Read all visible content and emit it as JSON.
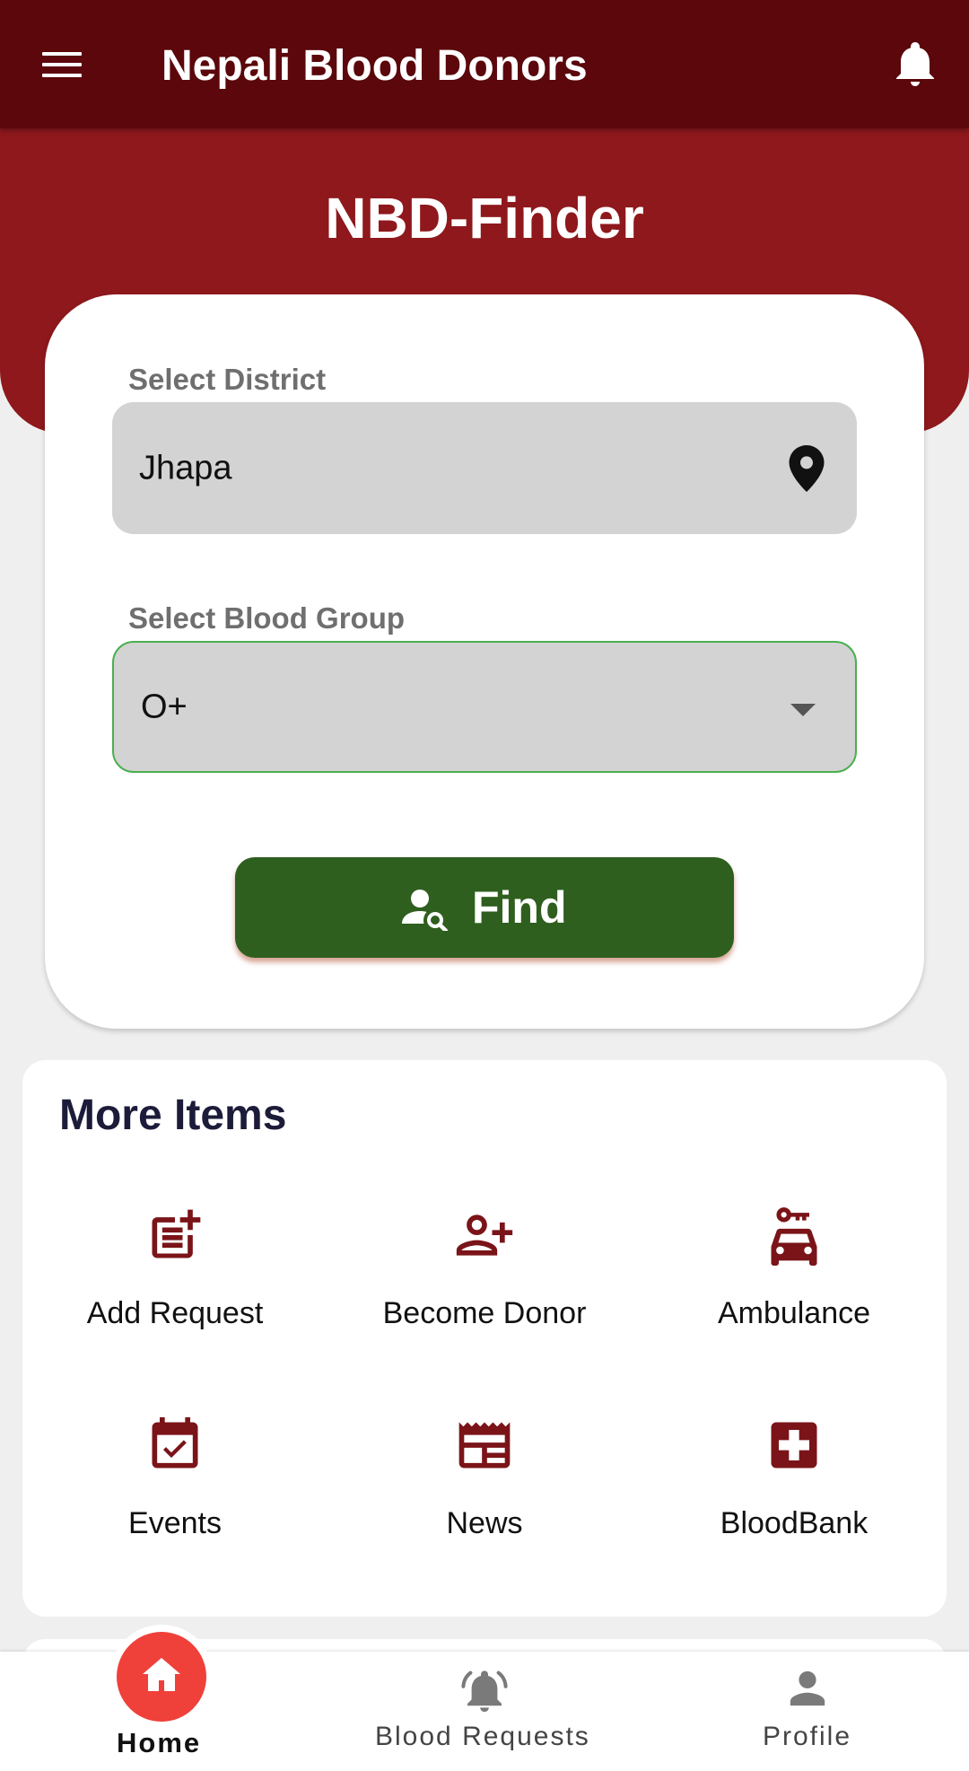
{
  "app_bar": {
    "title": "Nepali Blood Donors",
    "menu_icon": "menu-icon",
    "notification_icon": "bell-icon"
  },
  "hero": {
    "title": "NBD-Finder"
  },
  "finder": {
    "district": {
      "label": "Select District",
      "value": "Jhapa",
      "icon": "location-pin-icon"
    },
    "blood_group": {
      "label": "Select Blood Group",
      "value": "O+",
      "icon": "dropdown-caret-icon"
    },
    "find_button": {
      "label": "Find",
      "icon": "person-search-icon"
    }
  },
  "more_items": {
    "title": "More Items",
    "items": [
      {
        "label": "Add Request",
        "icon": "post-add-icon"
      },
      {
        "label": "Become Donor",
        "icon": "person-add-icon"
      },
      {
        "label": "Ambulance",
        "icon": "car-rental-icon"
      },
      {
        "label": "Events",
        "icon": "event-available-icon"
      },
      {
        "label": "News",
        "icon": "newspaper-icon"
      },
      {
        "label": "BloodBank",
        "icon": "medical-cross-icon"
      }
    ]
  },
  "bottom_nav": {
    "items": [
      {
        "label": "Home",
        "icon": "home-icon",
        "active": true
      },
      {
        "label": "Blood Requests",
        "icon": "notification-ringing-icon",
        "active": false
      },
      {
        "label": "Profile",
        "icon": "person-icon",
        "active": false
      }
    ]
  },
  "colors": {
    "app_bar": "#5b070b",
    "hero": "#8e181c",
    "find_button": "#2e5f1e",
    "icon_accent": "#7a1418",
    "home_active": "#f0403a",
    "field_focus_border": "#4caf50"
  }
}
